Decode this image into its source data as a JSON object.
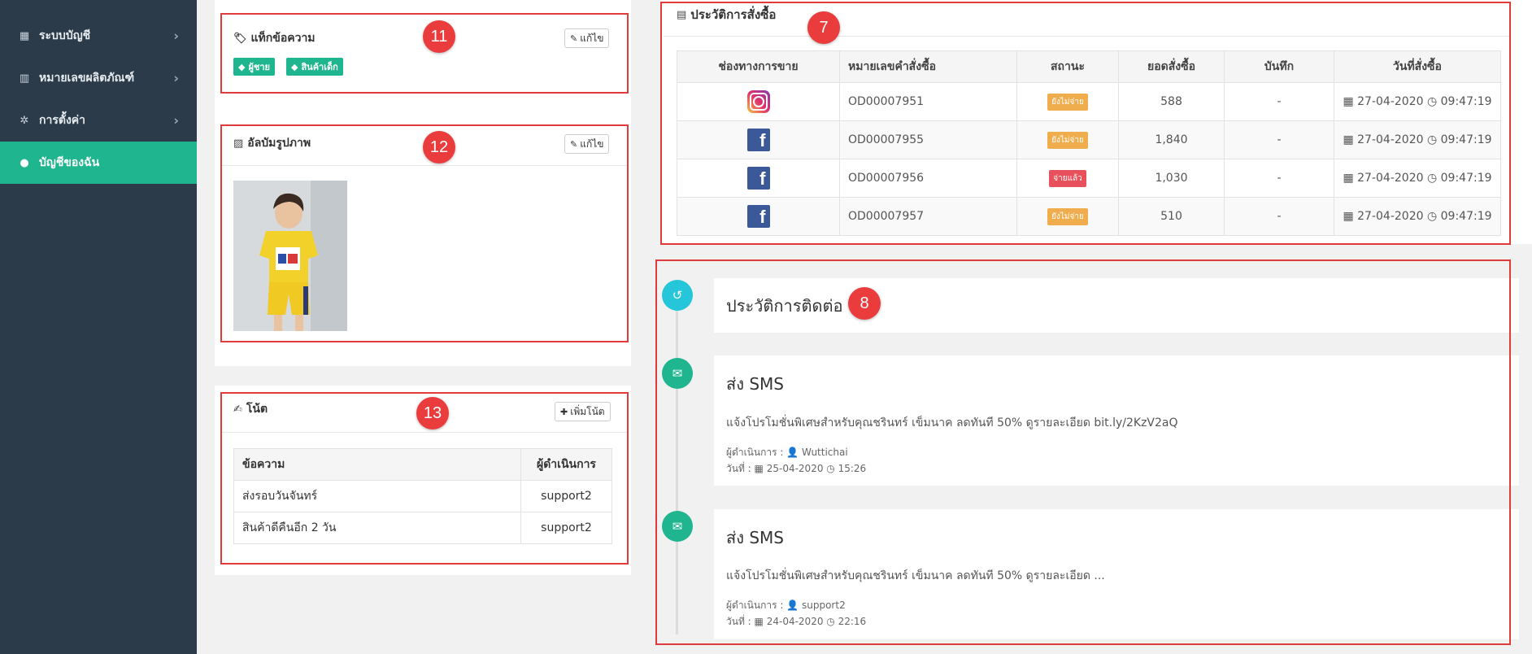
{
  "sidebar": {
    "items": [
      {
        "label": "ระบบบัญชี",
        "icon": "calculator-icon",
        "active": false
      },
      {
        "label": "หมายเลขผลิตภัณฑ์",
        "icon": "barcode-icon",
        "active": false
      },
      {
        "label": "การตั้งค่า",
        "icon": "gear-icon",
        "active": false
      },
      {
        "label": "บัญชีของฉัน",
        "icon": "user-circle-icon",
        "active": true
      }
    ]
  },
  "tags_card": {
    "title": "แท็กข้อความ",
    "edit_label": "แก้ไข",
    "tags": [
      "ผู้ชาย",
      "สินค้าเด็ก"
    ],
    "marker": "11"
  },
  "album_card": {
    "title": "อัลบัมรูปภาพ",
    "edit_label": "แก้ไข",
    "marker": "12"
  },
  "notes_card": {
    "title": "โน้ต",
    "add_label": "เพิ่มโน้ต",
    "marker": "13",
    "columns": [
      "ข้อความ",
      "ผู้ดำเนินการ"
    ],
    "rows": [
      {
        "message": "ส่งรอบวันจันทร์",
        "by": "support2"
      },
      {
        "message": "สินค้าดีคืนอีก 2 วัน",
        "by": "support2"
      }
    ]
  },
  "orders_card": {
    "title": "ประวัติการสั่งซื้อ",
    "marker": "7",
    "columns": [
      "ช่องทางการขาย",
      "หมายเลขคำสั่งซื้อ",
      "สถานะ",
      "ยอดสั่งซื้อ",
      "บันทึก",
      "วันที่สั่งซื้อ"
    ],
    "rows": [
      {
        "channel": "instagram",
        "order_no": "OD00007951",
        "status": "ยังไม่จ่าย",
        "status_type": "unpaid",
        "amount": "588",
        "note": "-",
        "date": "27-04-2020",
        "time": "09:47:19"
      },
      {
        "channel": "facebook",
        "order_no": "OD00007955",
        "status": "ยังไม่จ่าย",
        "status_type": "unpaid",
        "amount": "1,840",
        "note": "-",
        "date": "27-04-2020",
        "time": "09:47:19"
      },
      {
        "channel": "facebook",
        "order_no": "OD00007956",
        "status": "จ่ายแล้ว",
        "status_type": "paid",
        "amount": "1,030",
        "note": "-",
        "date": "27-04-2020",
        "time": "09:47:19"
      },
      {
        "channel": "facebook",
        "order_no": "OD00007957",
        "status": "ยังไม่จ่าย",
        "status_type": "unpaid",
        "amount": "510",
        "note": "-",
        "date": "27-04-2020",
        "time": "09:47:19"
      }
    ]
  },
  "contact_history": {
    "title": "ประวัติการติดต่อ",
    "marker": "8",
    "entries": [
      {
        "title": "ส่ง SMS",
        "message": "แจ้งโปรโมชั่นพิเศษสำหรับคุณชรินทร์ เข็มนาค ลดทันที 50% ดูรายละเอียด bit.ly/2KzV2aQ",
        "by_label": "ผู้ดำเนินการ :",
        "by": "Wuttichai",
        "date_label": "วันที่ :",
        "date": "25-04-2020",
        "time": "15:26"
      },
      {
        "title": "ส่ง SMS",
        "message": "แจ้งโปรโมชั่นพิเศษสำหรับคุณชรินทร์ เข็มนาค ลดทันที 50% ดูรายละเอียด ...",
        "by_label": "ผู้ดำเนินการ :",
        "by": "support2",
        "date_label": "วันที่ :",
        "date": "24-04-2020",
        "time": "22:16"
      }
    ]
  },
  "colors": {
    "sidebar_bg": "#2b3b4a",
    "accent": "#1fb58f",
    "annotation_red": "#e23b3b",
    "status_unpaid": "#f0ad4e",
    "status_paid": "#e8505b"
  }
}
